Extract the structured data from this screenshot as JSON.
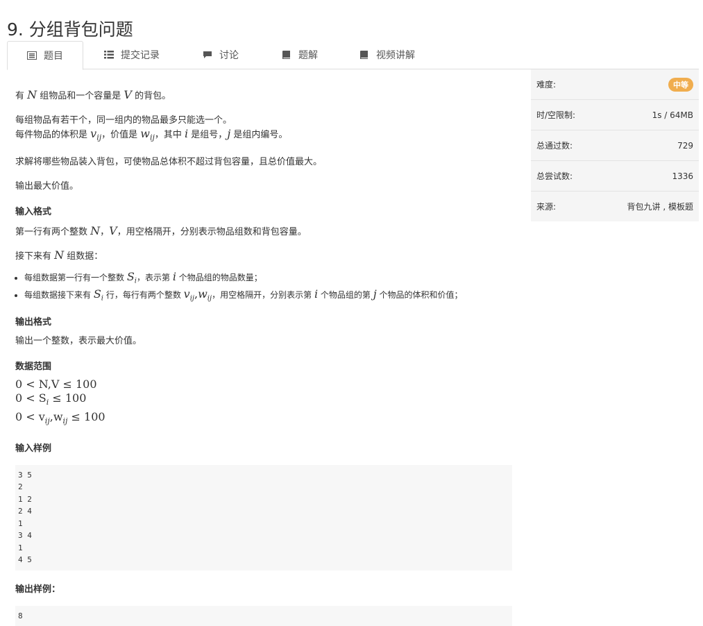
{
  "page_title": "9. 分组背包问题",
  "tabs": [
    {
      "label": "题目",
      "icon": "list-icon"
    },
    {
      "label": "提交记录",
      "icon": "bullet-list-icon"
    },
    {
      "label": "讨论",
      "icon": "comment-icon"
    },
    {
      "label": "题解",
      "icon": "book-icon"
    },
    {
      "label": "视频讲解",
      "icon": "book-icon"
    }
  ],
  "problem": {
    "intro_a": "有 ",
    "N": "N",
    "intro_b": " 组物品和一个容量是 ",
    "V": "V",
    "intro_c": " 的背包。",
    "p2_line1": "每组物品有若干个，同一组内的物品最多只能选一个。",
    "p2_a": "每件物品的体积是 ",
    "v": "v",
    "ij": "ij",
    "p2_b": "，价值是 ",
    "w": "w",
    "p2_c": "，其中 ",
    "i": "i",
    "p2_d": " 是组号，",
    "j": "j",
    "p2_e": " 是组内编号。",
    "p3": "求解将哪些物品装入背包，可使物品总体积不超过背包容量，且总价值最大。",
    "p4": "输出最大价值。",
    "input_heading": "输入格式",
    "in1_a": "第一行有两个整数 ",
    "comma": "，",
    "in1_b": "，用空格隔开，分别表示物品组数和背包容量。",
    "in2_a": "接下来有 ",
    "in2_b": " 组数据：",
    "li1_a": "每组数据第一行有一个整数 ",
    "S": "S",
    "li1_b": "，表示第 ",
    "li1_c": " 个物品组的物品数量；",
    "li2_a": "每组数据接下来有 ",
    "li2_b": " 行，每行有两个整数 ",
    "li2_c": "，用空格隔开，分别表示第 ",
    "li2_d": " 个物品组的第 ",
    "li2_e": " 个物品的体积和价值；",
    "output_heading": "输出格式",
    "out1": "输出一个整数，表示最大价值。",
    "range_heading": "数据范围",
    "range_lines": [
      "0 < N,V ≤ 100",
      "0 < S",
      "≤ 100",
      "0 < v",
      ",w",
      "≤ 100"
    ],
    "sample_in_heading": "输入样例",
    "sample_in": "3 5\n2\n1 2\n2 4\n1\n3 4\n1\n4 5",
    "sample_out_heading": "输出样例：",
    "sample_out": "8"
  },
  "sidebar": {
    "difficulty_label": "难度:",
    "difficulty_value": "中等",
    "limit_label": "时/空限制:",
    "limit_value": "1s / 64MB",
    "passed_label": "总通过数:",
    "passed_value": "729",
    "tried_label": "总尝试数:",
    "tried_value": "1336",
    "source_label": "来源:",
    "source_value": "背包九讲 , 模板题"
  },
  "colors": {
    "badge": "#f0ad4e",
    "sidebar_bg": "#f5f5f5",
    "code_bg": "#f7f7f7"
  }
}
